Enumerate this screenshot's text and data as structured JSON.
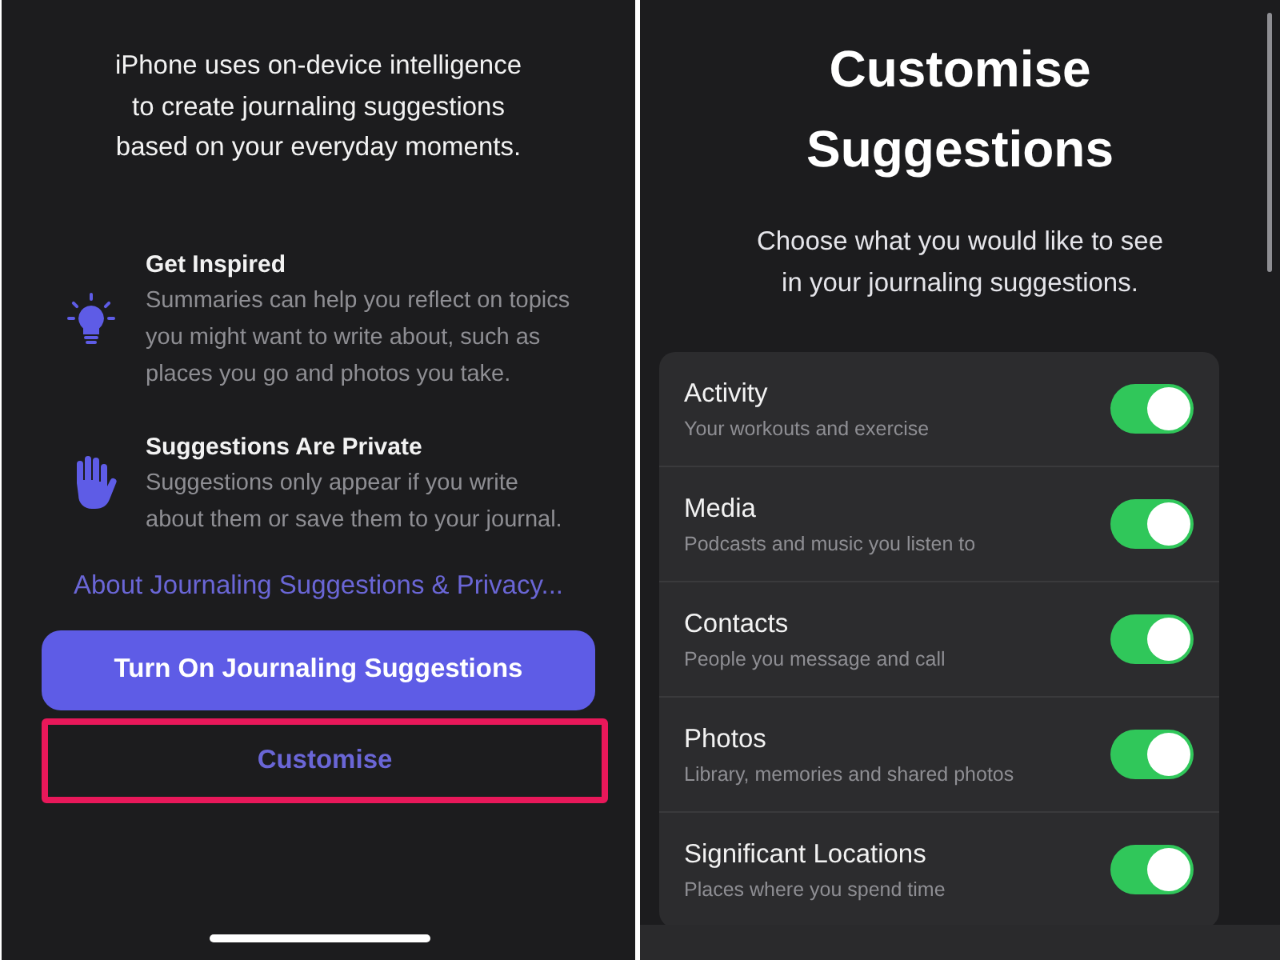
{
  "intro_screen": {
    "intro_lines": [
      "iPhone uses on-device intelligence",
      "to create journaling suggestions",
      "based on your everyday moments."
    ],
    "features": [
      {
        "kind": "bulb",
        "title": "Get Inspired",
        "description": "Summaries can help you reflect on topics you might want to write about, such as places you go and photos you take."
      },
      {
        "kind": "hand",
        "title": "Suggestions Are Private",
        "description": "Suggestions only appear if you write about them or save them to your journal."
      }
    ],
    "privacy_link": "About Journaling Suggestions & Privacy...",
    "primary_button": "Turn On Journaling Suggestions",
    "secondary_button": {
      "label": "Customise",
      "highlighted": true
    }
  },
  "customise_screen": {
    "title": "Customise Suggestions",
    "subtitle_lines": [
      "Choose what you would like to see",
      "in your journaling suggestions."
    ],
    "options": [
      {
        "title": "Activity",
        "subtitle": "Your workouts and exercise",
        "on": true
      },
      {
        "title": "Media",
        "subtitle": "Podcasts and music you listen to",
        "on": true
      },
      {
        "title": "Contacts",
        "subtitle": "People you message and call",
        "on": true
      },
      {
        "title": "Photos",
        "subtitle": "Library, memories and shared photos",
        "on": true
      },
      {
        "title": "Significant Locations",
        "subtitle": "Places where you spend time",
        "on": true
      }
    ]
  }
}
